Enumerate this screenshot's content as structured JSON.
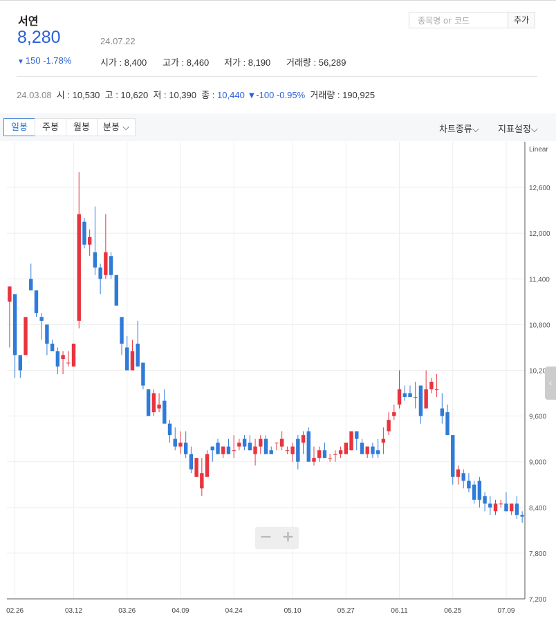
{
  "stock": {
    "name": "서연",
    "price": "8,280",
    "date": "24.07.22",
    "change": "150 -1.78%",
    "open": "시가 : 8,400",
    "high": "고가 : 8,460",
    "low": "저가 : 8,190",
    "volume": "거래량 : 56,289"
  },
  "search": {
    "placeholder": "종목명 or 코드",
    "add_label": "추가"
  },
  "prev_day": {
    "date": "24.03.08",
    "open": "시 : 10,530",
    "high": "고 : 10,620",
    "low": "저 : 10,390",
    "close_label": "종 :",
    "close_value": "10,440",
    "change": "▼-100 -0.95%",
    "volume": "거래량 : 190,925"
  },
  "tabs": [
    "일봉",
    "주봉",
    "월봉",
    "분봉"
  ],
  "toolbar": {
    "chart_type": "차트종류",
    "indicator": "지표설정"
  },
  "colors": {
    "up": "#e8343f",
    "down": "#2f7bd8",
    "accent": "#2a5fd8"
  },
  "chart_data": {
    "type": "candlestick",
    "scale_label": "Linear",
    "ylim": [
      7200,
      13200
    ],
    "yticks": [
      "12,600",
      "12,000",
      "11,400",
      "10,800",
      "10,200",
      "9,600",
      "9,000",
      "8,400",
      "7,800",
      "7,200"
    ],
    "ytick_values": [
      12600,
      12000,
      11400,
      10800,
      10200,
      9600,
      9000,
      8400,
      7800,
      7200
    ],
    "xticks": [
      "02.26",
      "03.12",
      "03.26",
      "04.09",
      "04.24",
      "05.10",
      "05.27",
      "06.11",
      "06.25",
      "07.09"
    ],
    "xtick_index": [
      1,
      12,
      22,
      32,
      42,
      53,
      63,
      73,
      83,
      93
    ],
    "ohlc": [
      [
        11100,
        11300,
        10500,
        11300
      ],
      [
        11200,
        11200,
        10100,
        10400
      ],
      [
        10400,
        10200,
        10100,
        10200
      ],
      [
        10400,
        10900,
        10400,
        10900
      ],
      [
        11400,
        11600,
        11250,
        11250
      ],
      [
        11250,
        11250,
        10900,
        10950
      ],
      [
        10900,
        10950,
        10600,
        10850
      ],
      [
        10800,
        10800,
        10400,
        10550
      ],
      [
        10550,
        10600,
        10450,
        10450
      ],
      [
        10450,
        10500,
        10150,
        10250
      ],
      [
        10350,
        10450,
        10150,
        10400
      ],
      [
        10300,
        10450,
        10250,
        10300
      ],
      [
        10250,
        10550,
        10250,
        10550
      ],
      [
        10850,
        12800,
        10750,
        12250
      ],
      [
        12150,
        12200,
        11800,
        11850
      ],
      [
        11850,
        12050,
        11700,
        11950
      ],
      [
        11750,
        12350,
        11450,
        11550
      ],
      [
        11550,
        11600,
        11200,
        11400
      ],
      [
        11450,
        12250,
        11400,
        11750
      ],
      [
        11700,
        11750,
        11400,
        11450
      ],
      [
        11450,
        11450,
        11050,
        11050
      ],
      [
        10900,
        10900,
        10400,
        10550
      ],
      [
        10500,
        10650,
        10200,
        10200
      ],
      [
        10200,
        10600,
        10200,
        10450
      ],
      [
        10550,
        10850,
        10300,
        10250
      ],
      [
        10300,
        10300,
        9950,
        10000
      ],
      [
        9950,
        9950,
        9800,
        9600
      ],
      [
        9650,
        9950,
        9600,
        9900
      ],
      [
        9700,
        9900,
        9650,
        9750
      ],
      [
        9800,
        9950,
        9500,
        9500
      ],
      [
        9500,
        9550,
        9250,
        9350
      ],
      [
        9300,
        9450,
        9150,
        9200
      ],
      [
        9200,
        9400,
        9100,
        9250
      ],
      [
        9250,
        9400,
        9050,
        9100
      ],
      [
        9100,
        9200,
        8850,
        8900
      ],
      [
        8800,
        9050,
        8800,
        9050
      ],
      [
        8650,
        9050,
        8550,
        8850
      ],
      [
        8800,
        9150,
        8800,
        9100
      ],
      [
        9200,
        9200,
        9000,
        9150
      ],
      [
        9250,
        9300,
        9100,
        9100
      ],
      [
        9100,
        9200,
        9050,
        9200
      ],
      [
        9200,
        9300,
        9100,
        9100
      ],
      [
        9150,
        9350,
        9050,
        9150
      ],
      [
        9200,
        9300,
        9150,
        9250
      ],
      [
        9300,
        9350,
        9150,
        9200
      ],
      [
        9250,
        9350,
        9150,
        9150
      ],
      [
        9100,
        9300,
        8950,
        9200
      ],
      [
        9200,
        9350,
        9100,
        9300
      ],
      [
        9300,
        9350,
        9100,
        9100
      ],
      [
        9150,
        9200,
        9100,
        9100
      ],
      [
        9250,
        9250,
        9150,
        9250
      ],
      [
        9200,
        9400,
        9150,
        9300
      ],
      [
        9150,
        9200,
        9100,
        9150
      ],
      [
        9100,
        9250,
        9000,
        9200
      ],
      [
        9300,
        9350,
        8900,
        9000
      ],
      [
        9250,
        9400,
        9100,
        9350
      ],
      [
        9400,
        9450,
        9000,
        9000
      ],
      [
        9000,
        9200,
        8950,
        9050
      ],
      [
        9050,
        9200,
        9000,
        9150
      ],
      [
        9150,
        9250,
        9050,
        9050
      ],
      [
        9050,
        9100,
        9000,
        9050
      ],
      [
        9100,
        9150,
        9000,
        9100
      ],
      [
        9100,
        9200,
        9050,
        9150
      ],
      [
        9100,
        9250,
        9100,
        9250
      ],
      [
        9150,
        9400,
        9150,
        9400
      ],
      [
        9400,
        9400,
        9150,
        9300
      ],
      [
        9250,
        9300,
        9100,
        9100
      ],
      [
        9100,
        9200,
        9050,
        9200
      ],
      [
        9200,
        9250,
        9050,
        9100
      ],
      [
        9150,
        9300,
        9050,
        9100
      ],
      [
        9250,
        9450,
        9100,
        9300
      ],
      [
        9400,
        9650,
        9350,
        9550
      ],
      [
        9600,
        9750,
        9550,
        9650
      ],
      [
        9750,
        10200,
        9700,
        9950
      ],
      [
        9900,
        10000,
        9800,
        9850
      ],
      [
        9900,
        10000,
        9850,
        9850
      ],
      [
        9850,
        10050,
        9700,
        9850
      ],
      [
        10000,
        10000,
        9500,
        9600
      ],
      [
        9700,
        10200,
        9700,
        9950
      ],
      [
        9950,
        10100,
        9900,
        10050
      ],
      [
        9950,
        10150,
        9850,
        9950
      ],
      [
        9700,
        9900,
        9500,
        9600
      ],
      [
        9650,
        9750,
        9350,
        9350
      ],
      [
        9350,
        9350,
        8700,
        8800
      ],
      [
        8800,
        8950,
        8700,
        8900
      ],
      [
        8850,
        8900,
        8650,
        8750
      ],
      [
        8750,
        8850,
        8600,
        8650
      ],
      [
        8700,
        8750,
        8450,
        8500
      ],
      [
        8750,
        8800,
        8400,
        8500
      ],
      [
        8550,
        8600,
        8350,
        8450
      ],
      [
        8450,
        8550,
        8300,
        8400
      ],
      [
        8350,
        8500,
        8300,
        8450
      ],
      [
        8450,
        8500,
        8400,
        8450
      ],
      [
        8450,
        8600,
        8350,
        8350
      ],
      [
        8350,
        8450,
        8300,
        8450
      ],
      [
        8450,
        8550,
        8250,
        8300
      ],
      [
        8300,
        8350,
        8200,
        8280
      ]
    ]
  }
}
